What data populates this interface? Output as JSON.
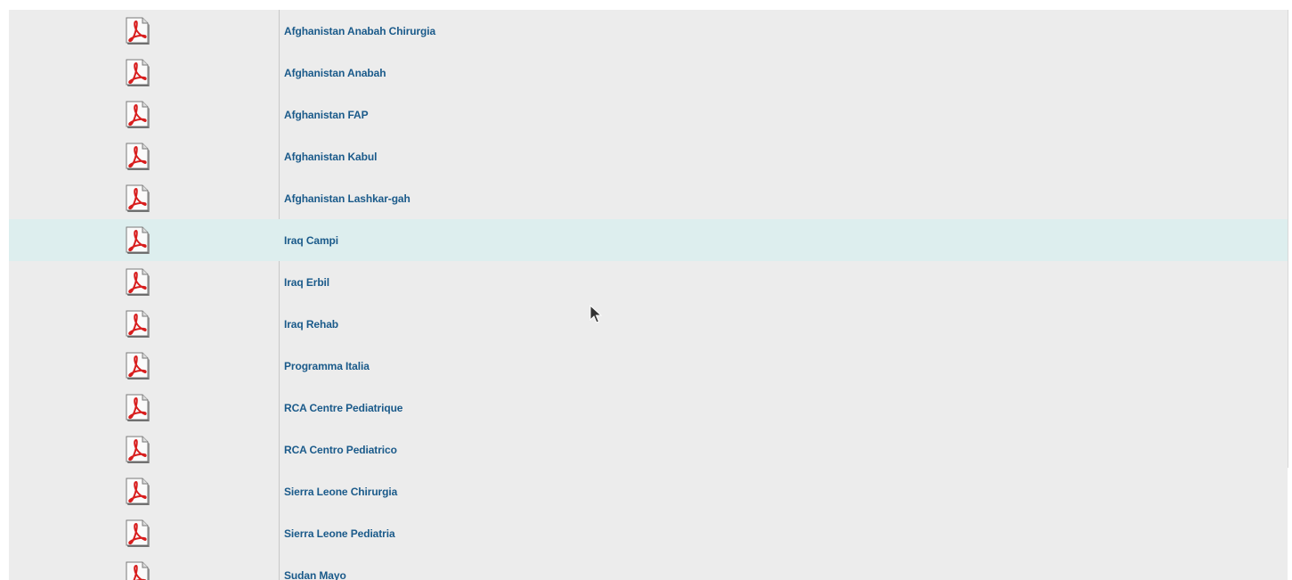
{
  "list": {
    "rows": [
      {
        "label": "Afghanistan Anabah Chirurgia"
      },
      {
        "label": "Afghanistan Anabah"
      },
      {
        "label": "Afghanistan FAP"
      },
      {
        "label": "Afghanistan Kabul"
      },
      {
        "label": "Afghanistan Lashkar-gah"
      },
      {
        "label": "Iraq Campi",
        "highlighted": true
      },
      {
        "label": "Iraq Erbil"
      },
      {
        "label": "Iraq Rehab"
      },
      {
        "label": "Programma Italia"
      },
      {
        "label": "RCA Centre Pediatrique"
      },
      {
        "label": "RCA Centro Pediatrico"
      },
      {
        "label": "Sierra Leone Chirurgia"
      },
      {
        "label": "Sierra Leone Pediatria"
      },
      {
        "label": "Sudan Mayo"
      }
    ],
    "icon": "pdf-file-icon"
  },
  "colors": {
    "row_background": "#ececec",
    "row_highlight": "#ddeeee",
    "link_text": "#1a5a8a",
    "pdf_red": "#d81e1e"
  }
}
